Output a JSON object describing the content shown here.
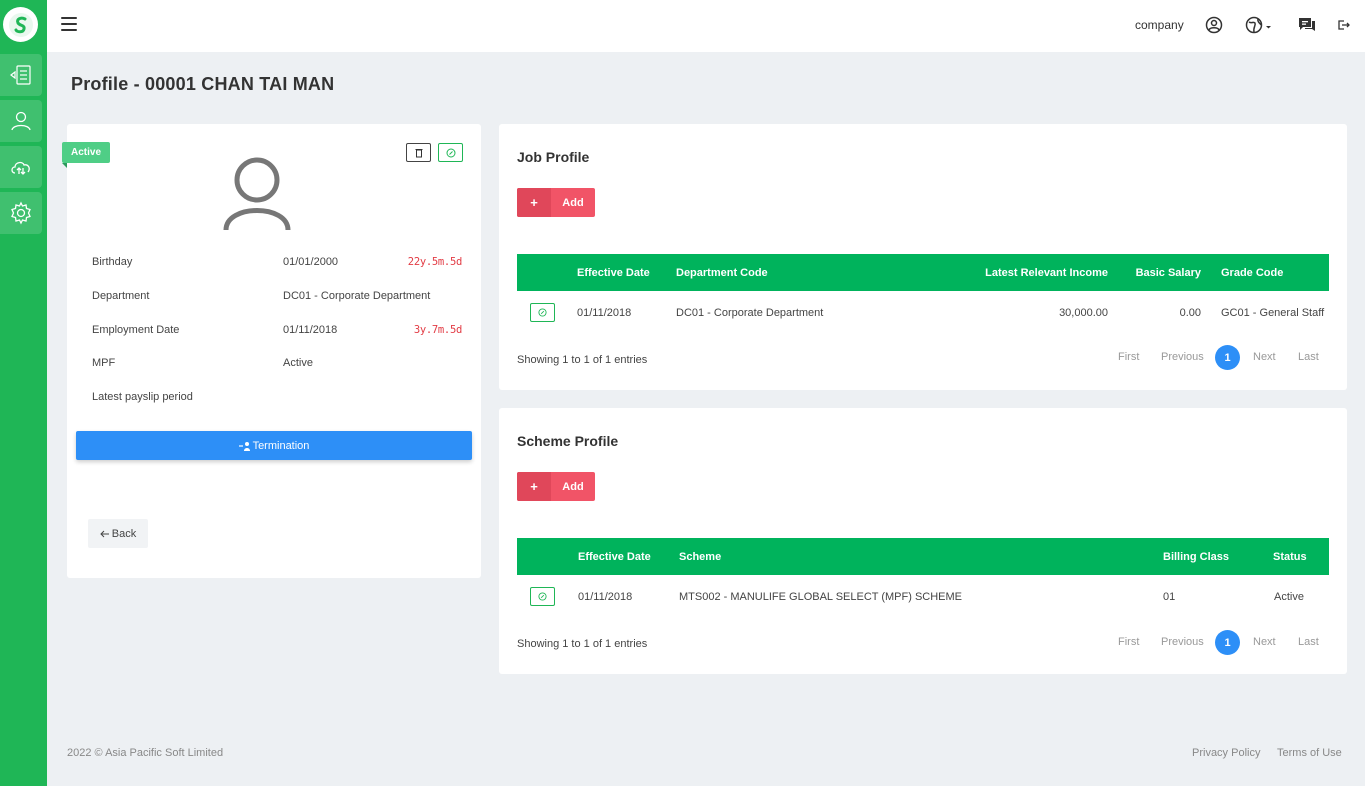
{
  "header": {
    "company_label": "company",
    "icons": [
      "menu-icon",
      "user-circle-icon",
      "globe-icon",
      "chat-icon",
      "logout-icon"
    ]
  },
  "sidebar": {
    "items": [
      {
        "icon": "document-list-icon"
      },
      {
        "icon": "user-icon"
      },
      {
        "icon": "cloud-sync-icon"
      },
      {
        "icon": "gear-icon"
      }
    ]
  },
  "page": {
    "title": "Profile - 00001 CHAN TAI MAN"
  },
  "profile": {
    "status_badge": "Active",
    "fields": {
      "birthday_label": "Birthday",
      "birthday_value": "01/01/2000",
      "birthday_age": "22y.5m.5d",
      "department_label": "Department",
      "department_value": "DC01 - Corporate Department",
      "employment_label": "Employment Date",
      "employment_value": "01/11/2018",
      "employment_duration": "3y.7m.5d",
      "mpf_label": "MPF",
      "mpf_value": "Active",
      "payslip_label": "Latest payslip period"
    },
    "termination_label": "Termination",
    "back_label": "Back"
  },
  "job_profile": {
    "title": "Job Profile",
    "add_label": "Add",
    "columns": [
      "Effective Date",
      "Department Code",
      "Latest Relevant Income",
      "Basic Salary",
      "Grade Code"
    ],
    "rows": [
      {
        "effective_date": "01/11/2018",
        "department_code": "DC01 - Corporate Department",
        "income": "30,000.00",
        "basic_salary": "0.00",
        "grade_code": "GC01 - General Staff"
      }
    ],
    "showing": "Showing 1 to 1 of 1 entries",
    "pager": {
      "first": "First",
      "previous": "Previous",
      "current": "1",
      "next": "Next",
      "last": "Last"
    }
  },
  "scheme_profile": {
    "title": "Scheme Profile",
    "add_label": "Add",
    "columns": [
      "Effective Date",
      "Scheme",
      "Billing Class",
      "Status"
    ],
    "rows": [
      {
        "effective_date": "01/11/2018",
        "scheme": "MTS002 - MANULIFE GLOBAL SELECT (MPF) SCHEME",
        "billing_class": "01",
        "status": "Active"
      }
    ],
    "showing": "Showing 1 to 1 of 1 entries",
    "pager": {
      "first": "First",
      "previous": "Previous",
      "current": "1",
      "next": "Next",
      "last": "Last"
    }
  },
  "footer": {
    "copyright": "2022 © Asia Pacific Soft Limited",
    "privacy": "Privacy Policy",
    "terms": "Terms of Use"
  },
  "colors": {
    "brand_green": "#1fb656",
    "table_header": "#00b35c",
    "primary_blue": "#2d8ff7",
    "danger_red": "#f15467",
    "duration_red": "#e23b44"
  }
}
